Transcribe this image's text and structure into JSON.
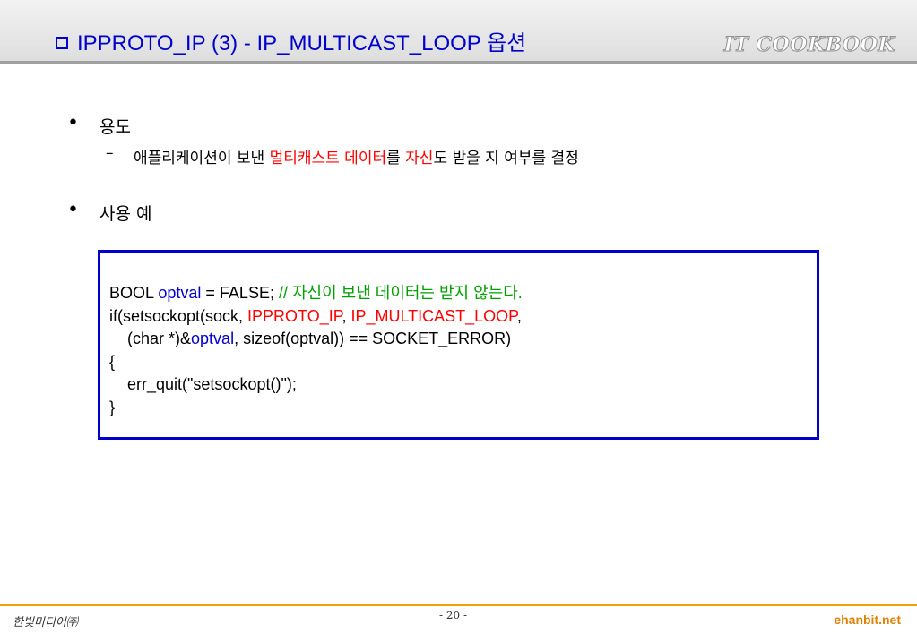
{
  "header": {
    "title": "IPPROTO_IP (3) - IP_MULTICAST_LOOP 옵션",
    "brand": "IT COOKBOOK"
  },
  "bullets": [
    {
      "marker": "•",
      "label": "용도",
      "sub": {
        "marker": "–",
        "parts": [
          "애플리케이션이 보낸 ",
          "멀티캐스트 데이터",
          "를 ",
          "자신",
          "도 받을 지 여부를 결정"
        ]
      }
    },
    {
      "marker": "•",
      "label": "사용 예"
    }
  ],
  "code": {
    "line1": [
      "BOOL ",
      "optval",
      " = FALSE; ",
      "// 자신이 보낸 데이터는 받지 않는다."
    ],
    "line2": [
      "if(setsockopt(sock, ",
      "IPPROTO_IP",
      ", ",
      "IP_MULTICAST_LOOP",
      ","
    ],
    "line3": [
      "    (char *)&",
      "optval",
      ", sizeof(optval)) == SOCKET_ERROR)"
    ],
    "line4": "{",
    "line5": "    err_quit(\"setsockopt()\");",
    "line6": "}"
  },
  "footer": {
    "left": "한빛미디어㈜",
    "page": "- 20 -",
    "right": "ehanbit.net"
  },
  "colors": {
    "title": "#0000cc",
    "highlight": "#ff0000",
    "comment": "#00a000",
    "keyword": "#0000cc",
    "footer_rule": "#f0a000"
  }
}
